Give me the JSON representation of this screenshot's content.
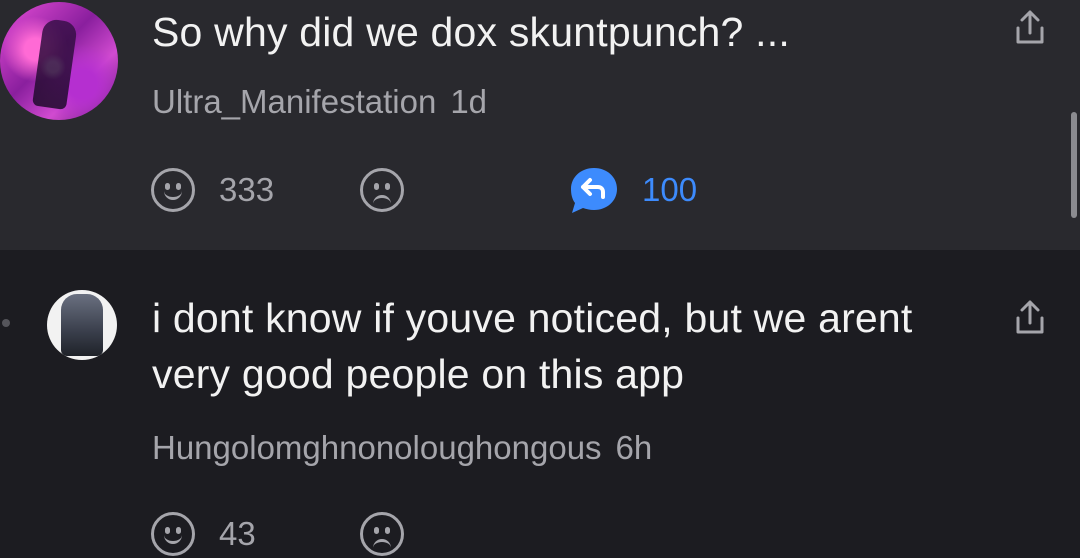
{
  "post": {
    "text": "So why did we dox skuntpunch? ...",
    "username": "Ultra_Manifestation",
    "time": "1d",
    "likes": "333",
    "replies": "100",
    "avatar_icon": "user-avatar"
  },
  "reply": {
    "text": "i dont know if youve noticed, but we arent very good people on this app",
    "username": "Hungolomghnonoloughongous",
    "time": "6h",
    "likes": "43",
    "avatar_icon": "user-avatar"
  },
  "icons": {
    "like": "smiley-icon",
    "dislike": "frown-icon",
    "reply": "reply-bubble-icon",
    "share": "share-icon"
  },
  "colors": {
    "post_background": "#29292e",
    "reply_background": "#1c1c21",
    "text": "#f2f2f2",
    "muted": "#a5a5ab",
    "accent": "#3d8bfd"
  }
}
